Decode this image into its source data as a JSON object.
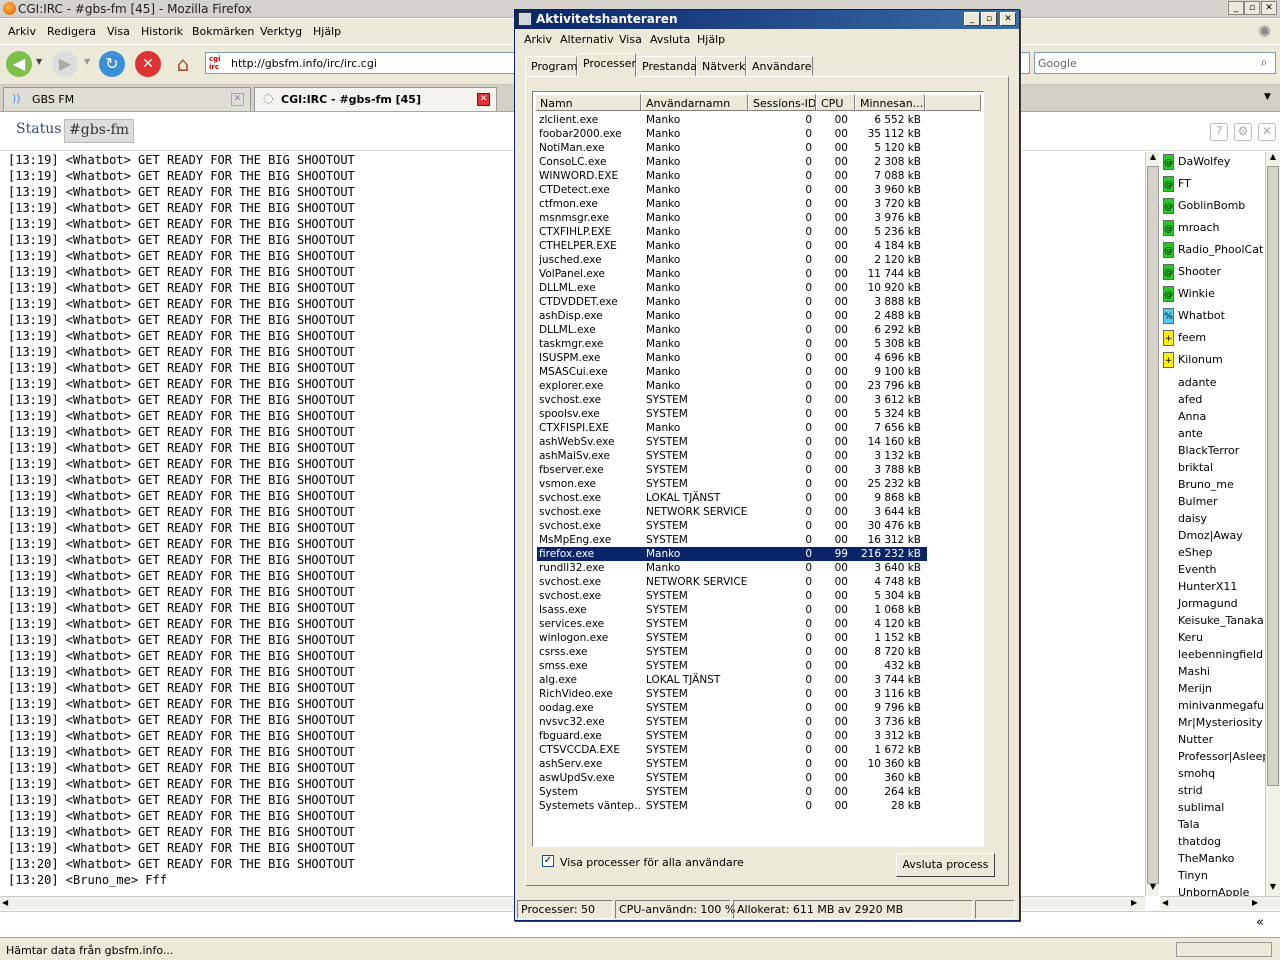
{
  "firefox": {
    "title": "CGI:IRC - #gbs-fm [45] - Mozilla Firefox",
    "menu": [
      "Arkiv",
      "Redigera",
      "Visa",
      "Historik",
      "Bokmärken",
      "Verktyg",
      "Hjälp"
    ],
    "url": "http://gbsfm.info/irc/irc.cgi",
    "url_favicon": "cgi irc",
    "search_placeholder": "Google",
    "tabs": [
      {
        "label": "GBS FM"
      },
      {
        "label": "CGI:IRC - #gbs-fm [45]"
      }
    ],
    "status_text": "Hämtar data från gbsfm.info..."
  },
  "irc": {
    "tabs": [
      "Status",
      "#gbs-fm"
    ],
    "log": [
      "[13:19] <Whatbot> GET READY FOR THE BIG SHOOTOUT",
      "[13:19] <Whatbot> GET READY FOR THE BIG SHOOTOUT",
      "[13:19] <Whatbot> GET READY FOR THE BIG SHOOTOUT",
      "[13:19] <Whatbot> GET READY FOR THE BIG SHOOTOUT",
      "[13:19] <Whatbot> GET READY FOR THE BIG SHOOTOUT",
      "[13:19] <Whatbot> GET READY FOR THE BIG SHOOTOUT",
      "[13:19] <Whatbot> GET READY FOR THE BIG SHOOTOUT",
      "[13:19] <Whatbot> GET READY FOR THE BIG SHOOTOUT",
      "[13:19] <Whatbot> GET READY FOR THE BIG SHOOTOUT",
      "[13:19] <Whatbot> GET READY FOR THE BIG SHOOTOUT",
      "[13:19] <Whatbot> GET READY FOR THE BIG SHOOTOUT",
      "[13:19] <Whatbot> GET READY FOR THE BIG SHOOTOUT",
      "[13:19] <Whatbot> GET READY FOR THE BIG SHOOTOUT",
      "[13:19] <Whatbot> GET READY FOR THE BIG SHOOTOUT",
      "[13:19] <Whatbot> GET READY FOR THE BIG SHOOTOUT",
      "[13:19] <Whatbot> GET READY FOR THE BIG SHOOTOUT",
      "[13:19] <Whatbot> GET READY FOR THE BIG SHOOTOUT",
      "[13:19] <Whatbot> GET READY FOR THE BIG SHOOTOUT",
      "[13:19] <Whatbot> GET READY FOR THE BIG SHOOTOUT",
      "[13:19] <Whatbot> GET READY FOR THE BIG SHOOTOUT",
      "[13:19] <Whatbot> GET READY FOR THE BIG SHOOTOUT",
      "[13:19] <Whatbot> GET READY FOR THE BIG SHOOTOUT",
      "[13:19] <Whatbot> GET READY FOR THE BIG SHOOTOUT",
      "[13:19] <Whatbot> GET READY FOR THE BIG SHOOTOUT",
      "[13:19] <Whatbot> GET READY FOR THE BIG SHOOTOUT",
      "[13:19] <Whatbot> GET READY FOR THE BIG SHOOTOUT",
      "[13:19] <Whatbot> GET READY FOR THE BIG SHOOTOUT",
      "[13:19] <Whatbot> GET READY FOR THE BIG SHOOTOUT",
      "[13:19] <Whatbot> GET READY FOR THE BIG SHOOTOUT",
      "[13:19] <Whatbot> GET READY FOR THE BIG SHOOTOUT",
      "[13:19] <Whatbot> GET READY FOR THE BIG SHOOTOUT",
      "[13:19] <Whatbot> GET READY FOR THE BIG SHOOTOUT",
      "[13:19] <Whatbot> GET READY FOR THE BIG SHOOTOUT",
      "[13:19] <Whatbot> GET READY FOR THE BIG SHOOTOUT",
      "[13:19] <Whatbot> GET READY FOR THE BIG SHOOTOUT",
      "[13:19] <Whatbot> GET READY FOR THE BIG SHOOTOUT",
      "[13:19] <Whatbot> GET READY FOR THE BIG SHOOTOUT",
      "[13:19] <Whatbot> GET READY FOR THE BIG SHOOTOUT",
      "[13:19] <Whatbot> GET READY FOR THE BIG SHOOTOUT",
      "[13:19] <Whatbot> GET READY FOR THE BIG SHOOTOUT",
      "[13:19] <Whatbot> GET READY FOR THE BIG SHOOTOUT",
      "[13:19] <Whatbot> GET READY FOR THE BIG SHOOTOUT",
      "[13:19] <Whatbot> GET READY FOR THE BIG SHOOTOUT",
      "[13:19] <Whatbot> GET READY FOR THE BIG SHOOTOUT",
      "[13:20] <Whatbot> GET READY FOR THE BIG SHOOTOUT",
      "[13:20] <Bruno_me> Fff"
    ],
    "users": [
      {
        "badge": "@",
        "color": "#22cc22",
        "name": "DaWolfey"
      },
      {
        "badge": "@",
        "color": "#22cc22",
        "name": "FT"
      },
      {
        "badge": "@",
        "color": "#22cc22",
        "name": "GoblinBomb"
      },
      {
        "badge": "@",
        "color": "#22cc22",
        "name": "mroach"
      },
      {
        "badge": "@",
        "color": "#22cc22",
        "name": "Radio_PhoolCat"
      },
      {
        "badge": "@",
        "color": "#22cc22",
        "name": "Shooter"
      },
      {
        "badge": "@",
        "color": "#22cc22",
        "name": "Winkie"
      },
      {
        "badge": "%",
        "color": "#55ccee",
        "name": "Whatbot"
      },
      {
        "badge": "+",
        "color": "#ffee00",
        "name": "feem"
      },
      {
        "badge": "+",
        "color": "#ffee00",
        "name": "Kilonum"
      },
      {
        "badge": "",
        "color": "",
        "name": "adante"
      },
      {
        "badge": "",
        "color": "",
        "name": "afed"
      },
      {
        "badge": "",
        "color": "",
        "name": "Anna"
      },
      {
        "badge": "",
        "color": "",
        "name": "ante"
      },
      {
        "badge": "",
        "color": "",
        "name": "BlackTerror"
      },
      {
        "badge": "",
        "color": "",
        "name": "briktal"
      },
      {
        "badge": "",
        "color": "",
        "name": "Bruno_me"
      },
      {
        "badge": "",
        "color": "",
        "name": "Bulmer"
      },
      {
        "badge": "",
        "color": "",
        "name": "daisy"
      },
      {
        "badge": "",
        "color": "",
        "name": "Dmoz|Away"
      },
      {
        "badge": "",
        "color": "",
        "name": "eShep"
      },
      {
        "badge": "",
        "color": "",
        "name": "Eventh"
      },
      {
        "badge": "",
        "color": "",
        "name": "HunterX11"
      },
      {
        "badge": "",
        "color": "",
        "name": "Jormagund"
      },
      {
        "badge": "",
        "color": "",
        "name": "Keisuke_Tanaka"
      },
      {
        "badge": "",
        "color": "",
        "name": "Keru"
      },
      {
        "badge": "",
        "color": "",
        "name": "leebenningfield"
      },
      {
        "badge": "",
        "color": "",
        "name": "Mashi"
      },
      {
        "badge": "",
        "color": "",
        "name": "Merijn"
      },
      {
        "badge": "",
        "color": "",
        "name": "minivanmegafun"
      },
      {
        "badge": "",
        "color": "",
        "name": "Mr|Mysteriosity"
      },
      {
        "badge": "",
        "color": "",
        "name": "Nutter"
      },
      {
        "badge": "",
        "color": "",
        "name": "Professor|Asleepfa"
      },
      {
        "badge": "",
        "color": "",
        "name": "smohq"
      },
      {
        "badge": "",
        "color": "",
        "name": "strid"
      },
      {
        "badge": "",
        "color": "",
        "name": "sublimal"
      },
      {
        "badge": "",
        "color": "",
        "name": "Tala"
      },
      {
        "badge": "",
        "color": "",
        "name": "thatdog"
      },
      {
        "badge": "",
        "color": "",
        "name": "TheManko"
      },
      {
        "badge": "",
        "color": "",
        "name": "Tinyn"
      },
      {
        "badge": "",
        "color": "",
        "name": "UnbornApple"
      }
    ]
  },
  "taskmgr": {
    "title": "Aktivitetshanteraren",
    "menu": [
      "Arkiv",
      "Alternativ",
      "Visa",
      "Avsluta",
      "Hjälp"
    ],
    "tabs": [
      "Program",
      "Processer",
      "Prestanda",
      "Nätverk",
      "Användare"
    ],
    "active_tab": "Processer",
    "columns": [
      "Namn",
      "Användarnamn",
      "Sessions-ID",
      "CPU",
      "Minnesan..."
    ],
    "selected_row": "firefox.exe",
    "processes": [
      [
        "zlclient.exe",
        "Manko",
        "0",
        "00",
        "6 552 kB"
      ],
      [
        "foobar2000.exe",
        "Manko",
        "0",
        "00",
        "35 112 kB"
      ],
      [
        "NotiMan.exe",
        "Manko",
        "0",
        "00",
        "5 120 kB"
      ],
      [
        "ConsoLC.exe",
        "Manko",
        "0",
        "00",
        "2 308 kB"
      ],
      [
        "WINWORD.EXE",
        "Manko",
        "0",
        "00",
        "7 088 kB"
      ],
      [
        "CTDetect.exe",
        "Manko",
        "0",
        "00",
        "3 960 kB"
      ],
      [
        "ctfmon.exe",
        "Manko",
        "0",
        "00",
        "3 720 kB"
      ],
      [
        "msnmsgr.exe",
        "Manko",
        "0",
        "00",
        "3 976 kB"
      ],
      [
        "CTXFIHLP.EXE",
        "Manko",
        "0",
        "00",
        "5 236 kB"
      ],
      [
        "CTHELPER.EXE",
        "Manko",
        "0",
        "00",
        "4 184 kB"
      ],
      [
        "jusched.exe",
        "Manko",
        "0",
        "00",
        "2 120 kB"
      ],
      [
        "VolPanel.exe",
        "Manko",
        "0",
        "00",
        "11 744 kB"
      ],
      [
        "DLLML.exe",
        "Manko",
        "0",
        "00",
        "10 920 kB"
      ],
      [
        "CTDVDDET.exe",
        "Manko",
        "0",
        "00",
        "3 888 kB"
      ],
      [
        "ashDisp.exe",
        "Manko",
        "0",
        "00",
        "2 488 kB"
      ],
      [
        "DLLML.exe",
        "Manko",
        "0",
        "00",
        "6 292 kB"
      ],
      [
        "taskmgr.exe",
        "Manko",
        "0",
        "00",
        "5 308 kB"
      ],
      [
        "ISUSPM.exe",
        "Manko",
        "0",
        "00",
        "4 696 kB"
      ],
      [
        "MSASCui.exe",
        "Manko",
        "0",
        "00",
        "9 100 kB"
      ],
      [
        "explorer.exe",
        "Manko",
        "0",
        "00",
        "23 796 kB"
      ],
      [
        "svchost.exe",
        "SYSTEM",
        "0",
        "00",
        "3 612 kB"
      ],
      [
        "spoolsv.exe",
        "SYSTEM",
        "0",
        "00",
        "5 324 kB"
      ],
      [
        "CTXFISPI.EXE",
        "Manko",
        "0",
        "00",
        "7 656 kB"
      ],
      [
        "ashWebSv.exe",
        "SYSTEM",
        "0",
        "00",
        "14 160 kB"
      ],
      [
        "ashMaiSv.exe",
        "SYSTEM",
        "0",
        "00",
        "3 132 kB"
      ],
      [
        "fbserver.exe",
        "SYSTEM",
        "0",
        "00",
        "3 788 kB"
      ],
      [
        "vsmon.exe",
        "SYSTEM",
        "0",
        "00",
        "25 232 kB"
      ],
      [
        "svchost.exe",
        "LOKAL TJÄNST",
        "0",
        "00",
        "9 868 kB"
      ],
      [
        "svchost.exe",
        "NETWORK SERVICE",
        "0",
        "00",
        "3 644 kB"
      ],
      [
        "svchost.exe",
        "SYSTEM",
        "0",
        "00",
        "30 476 kB"
      ],
      [
        "MsMpEng.exe",
        "SYSTEM",
        "0",
        "00",
        "16 312 kB"
      ],
      [
        "firefox.exe",
        "Manko",
        "0",
        "99",
        "216 232 kB"
      ],
      [
        "rundll32.exe",
        "Manko",
        "0",
        "00",
        "3 640 kB"
      ],
      [
        "svchost.exe",
        "NETWORK SERVICE",
        "0",
        "00",
        "4 748 kB"
      ],
      [
        "svchost.exe",
        "SYSTEM",
        "0",
        "00",
        "5 304 kB"
      ],
      [
        "lsass.exe",
        "SYSTEM",
        "0",
        "00",
        "1 068 kB"
      ],
      [
        "services.exe",
        "SYSTEM",
        "0",
        "00",
        "4 120 kB"
      ],
      [
        "winlogon.exe",
        "SYSTEM",
        "0",
        "00",
        "1 152 kB"
      ],
      [
        "csrss.exe",
        "SYSTEM",
        "0",
        "00",
        "8 720 kB"
      ],
      [
        "smss.exe",
        "SYSTEM",
        "0",
        "00",
        "432 kB"
      ],
      [
        "alg.exe",
        "LOKAL TJÄNST",
        "0",
        "00",
        "3 744 kB"
      ],
      [
        "RichVideo.exe",
        "SYSTEM",
        "0",
        "00",
        "3 116 kB"
      ],
      [
        "oodag.exe",
        "SYSTEM",
        "0",
        "00",
        "9 796 kB"
      ],
      [
        "nvsvc32.exe",
        "SYSTEM",
        "0",
        "00",
        "3 736 kB"
      ],
      [
        "fbguard.exe",
        "SYSTEM",
        "0",
        "00",
        "3 312 kB"
      ],
      [
        "CTSVCCDA.EXE",
        "SYSTEM",
        "0",
        "00",
        "1 672 kB"
      ],
      [
        "ashServ.exe",
        "SYSTEM",
        "0",
        "00",
        "10 360 kB"
      ],
      [
        "aswUpdSv.exe",
        "SYSTEM",
        "0",
        "00",
        "360 kB"
      ],
      [
        "System",
        "SYSTEM",
        "0",
        "00",
        "264 kB"
      ],
      [
        "Systemets väntep...",
        "SYSTEM",
        "0",
        "00",
        "28 kB"
      ]
    ],
    "show_all_label": "Visa processer för alla användare",
    "show_all_checked": true,
    "end_process_label": "Avsluta process",
    "status": [
      "Processer: 50",
      "CPU-användn: 100 %",
      "Allokerat: 611 MB av 2920 MB"
    ]
  }
}
